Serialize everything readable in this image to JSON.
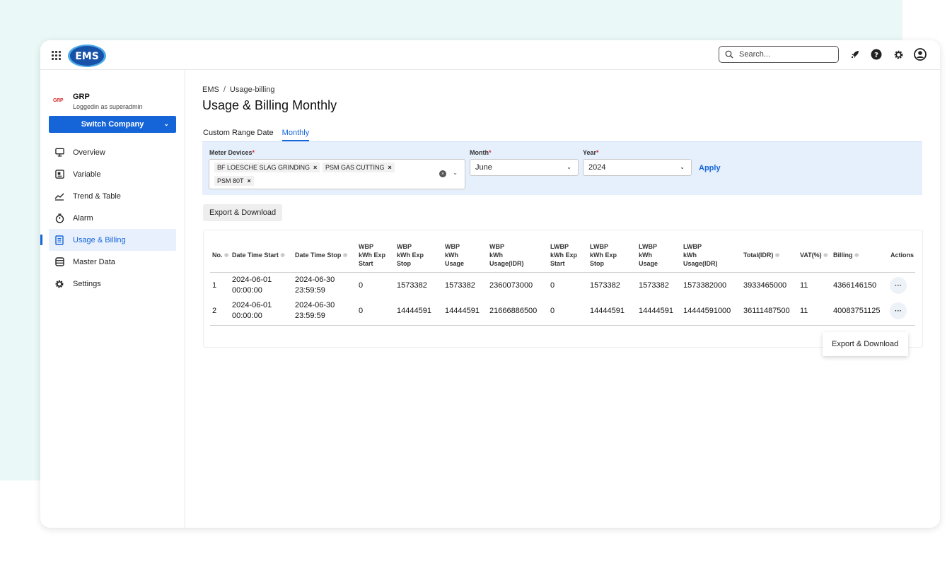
{
  "app": {
    "logo_text": "EMS",
    "search_placeholder": "Search...",
    "top_icons": [
      "rocket-icon",
      "help-icon",
      "settings-icon",
      "account-icon"
    ]
  },
  "sidebar": {
    "company_logo": "GRP",
    "company_name": "GRP",
    "company_sub": "Loggedin as superadmin",
    "switch_label": "Switch Company",
    "items": [
      {
        "label": "Overview",
        "icon": "monitor-icon"
      },
      {
        "label": "Variable",
        "icon": "variable-icon"
      },
      {
        "label": "Trend & Table",
        "icon": "trend-icon"
      },
      {
        "label": "Alarm",
        "icon": "alarm-icon"
      },
      {
        "label": "Usage & Billing",
        "icon": "billing-icon",
        "active": true
      },
      {
        "label": "Master Data",
        "icon": "database-icon"
      },
      {
        "label": "Settings",
        "icon": "gear-icon"
      }
    ]
  },
  "main": {
    "breadcrumb": [
      "EMS",
      "Usage-billing"
    ],
    "title": "Usage & Billing Monthly",
    "tabs": [
      {
        "label": "Custom Range Date"
      },
      {
        "label": "Monthly",
        "active": true
      }
    ],
    "filters": {
      "meter_label": "Meter Devices",
      "meter_chips": [
        "BF LOESCHE SLAG GRINDING",
        "PSM GAS CUTTING",
        "PSM 80T"
      ],
      "month_label": "Month",
      "month_value": "June",
      "year_label": "Year",
      "year_value": "2024",
      "apply_label": "Apply"
    },
    "export_label": "Export & Download",
    "table": {
      "columns": [
        [
          "No."
        ],
        [
          "Date Time Start"
        ],
        [
          "Date Time Stop"
        ],
        [
          "WBP",
          "kWh Exp",
          "Start"
        ],
        [
          "WBP",
          "kWh Exp",
          "Stop"
        ],
        [
          "WBP",
          "kWh",
          "Usage"
        ],
        [
          "WBP",
          "kWh",
          "Usage(IDR)"
        ],
        [
          "LWBP",
          "kWh Exp",
          "Start"
        ],
        [
          "LWBP",
          "kWh Exp",
          "Stop"
        ],
        [
          "LWBP",
          "kWh",
          "Usage"
        ],
        [
          "LWBP",
          "kWh",
          "Usage(IDR)"
        ],
        [
          "Total(IDR)"
        ],
        [
          "VAT(%)"
        ],
        [
          "Billing"
        ],
        [
          "Actions"
        ]
      ],
      "rows": [
        {
          "no": "1",
          "start_date": "2024-06-01",
          "start_time": "00:00:00",
          "stop_date": "2024-06-30",
          "stop_time": "23:59:59",
          "wbp_start": "0",
          "wbp_stop": "1573382",
          "wbp_usage": "1573382",
          "wbp_idr": "2360073000",
          "lwbp_start": "0",
          "lwbp_stop": "1573382",
          "lwbp_usage": "1573382",
          "lwbp_idr": "1573382000",
          "total": "3933465000",
          "vat": "11",
          "billing": "4366146150"
        },
        {
          "no": "2",
          "start_date": "2024-06-01",
          "start_time": "00:00:00",
          "stop_date": "2024-06-30",
          "stop_time": "23:59:59",
          "wbp_start": "0",
          "wbp_stop": "14444591",
          "wbp_usage": "14444591",
          "wbp_idr": "21666886500",
          "lwbp_start": "0",
          "lwbp_stop": "14444591",
          "lwbp_usage": "14444591",
          "lwbp_idr": "14444591000",
          "total": "36111487500",
          "vat": "11",
          "billing": "40083751125"
        }
      ],
      "action_menu_label": "Export & Download"
    }
  },
  "colors": {
    "accent": "#1565d8",
    "filter_bg": "#e6effc",
    "backdrop": "#eaf8f7"
  }
}
